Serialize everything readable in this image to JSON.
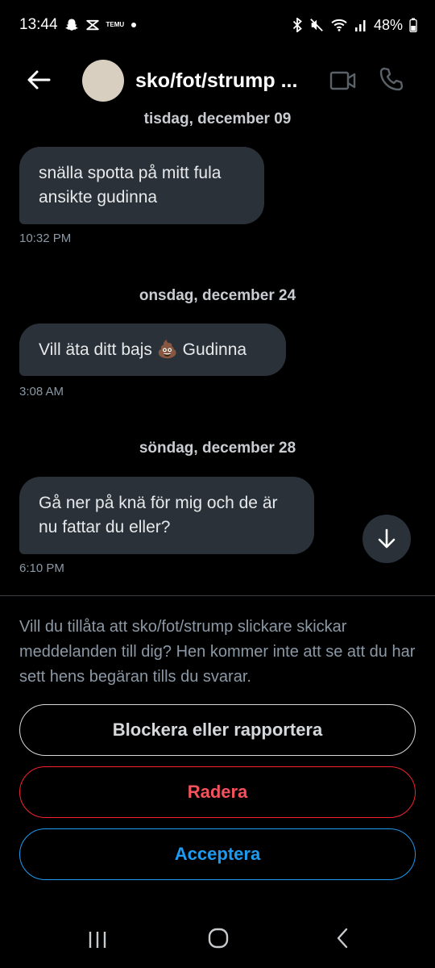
{
  "status_bar": {
    "time": "13:44",
    "temu_text": "TEMU",
    "battery": "48%",
    "icons": [
      "snapchat-icon",
      "capcut-icon",
      "temu-icon",
      "dot-icon",
      "bluetooth-icon",
      "mute-icon",
      "wifi-icon",
      "signal-icon",
      "battery-icon"
    ]
  },
  "header": {
    "contact_name": "sko/fot/strump ...",
    "icons": [
      "back-arrow-icon",
      "video-icon",
      "phone-icon"
    ]
  },
  "messages": [
    {
      "date": "tisdag, december 09",
      "lines": [
        "snälla spotta på mitt fula",
        "ansikte gudinna"
      ],
      "time": "10:32 PM"
    },
    {
      "date": "onsdag, december 24",
      "lines": [
        "Vill äta ditt bajs 💩 Gudinna"
      ],
      "time": "3:08 AM"
    },
    {
      "date": "söndag, december 28",
      "lines": [
        "Gå ner på knä för mig och de är",
        "nu fattar du eller?"
      ],
      "time": "6:10 PM"
    }
  ],
  "request": {
    "text": "Vill du tillåta att sko/fot/strump slickare skickar meddelanden till dig? Hen kommer inte att se att du har sett hens begäran tills du svarar."
  },
  "buttons": {
    "block": "Blockera eller rapportera",
    "delete": "Radera",
    "accept": "Acceptera"
  },
  "colors": {
    "background": "#000000",
    "bubble": "#2a3139",
    "accent": "#1d9bf0",
    "danger": "#f4212e",
    "muted": "#8b98a5"
  }
}
